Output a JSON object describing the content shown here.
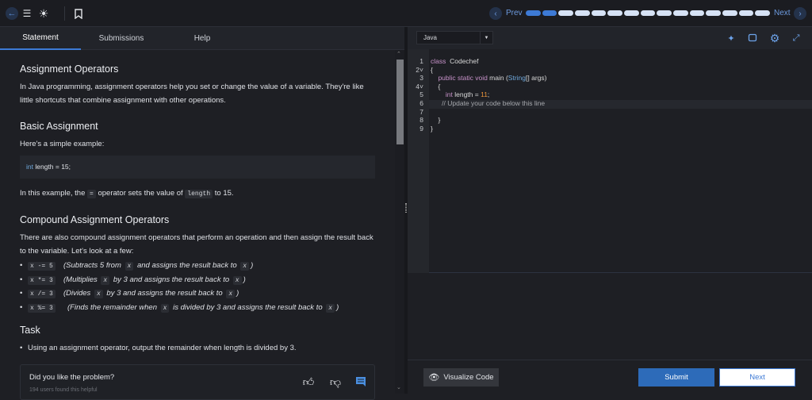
{
  "topbar": {
    "prev_label": "Prev",
    "next_label": "Next",
    "progress": {
      "total": 15,
      "completed": 2
    },
    "colors": {
      "done": "#3d7ad6",
      "todo": "#d6e2f5"
    }
  },
  "tabs": [
    {
      "label": "Statement"
    },
    {
      "label": "Submissions"
    },
    {
      "label": "Help"
    }
  ],
  "statement": {
    "title": "Assignment Operators",
    "intro": "In Java programming, assignment operators help you set or change the value of a variable. They're like little shortcuts that combine assignment with other operations.",
    "basic_heading": "Basic Assignment",
    "basic_text": "Here's a simple example:",
    "example_kw": "int",
    "example_rest": " length = 15;",
    "explain_pre": "In this example, the ",
    "explain_op": "=",
    "explain_mid": " operator sets the value of ",
    "explain_var": "length",
    "explain_post": " to 15.",
    "compound_heading": "Compound Assignment Operators",
    "compound_text": "There are also compound assignment operators that perform an operation and then assign the result back to the variable. Let's look at a few:",
    "ops": [
      {
        "op": "x -= 5",
        "desc": [
          "(Subtracts 5 from ",
          "x",
          " and assigns the result back to ",
          "x",
          ")"
        ]
      },
      {
        "op": "x *= 3",
        "desc": [
          "(Multiplies ",
          "x",
          " by 3 and assigns the result back to ",
          "x",
          ")"
        ]
      },
      {
        "op": "x /= 3",
        "desc": [
          "(Divides ",
          "x",
          " by 3 and assigns the result back to ",
          "x",
          ")"
        ]
      },
      {
        "op": "x %= 3",
        "desc": [
          "(Finds the remainder when ",
          "x",
          " is divided by 3 and assigns the result back to ",
          "x",
          ")"
        ]
      }
    ],
    "task_heading": "Task",
    "task_item": "Using an assignment operator, output the remainder when length is divided by 3."
  },
  "feedback": {
    "question": "Did you like the problem?",
    "helpful": "194 users found this helpful"
  },
  "editor": {
    "language": "Java",
    "lines": [
      [
        [
          "kw",
          "class"
        ],
        [
          "",
          "  Codechef"
        ]
      ],
      [
        [
          "",
          "{"
        ]
      ],
      [
        [
          "kw",
          "    public static void"
        ],
        [
          "",
          " main ("
        ],
        [
          "ty",
          "String"
        ],
        [
          "",
          "[] args)"
        ]
      ],
      [
        [
          "",
          "    {"
        ]
      ],
      [
        [
          "kw",
          "        int"
        ],
        [
          "",
          " length = "
        ],
        [
          "num",
          "11"
        ],
        [
          "",
          ";"
        ]
      ],
      [
        [
          "cm",
          "      // Update your code below this line"
        ]
      ],
      [
        [
          "",
          ""
        ]
      ],
      [
        [
          "",
          "    }"
        ]
      ],
      [
        [
          "",
          "}"
        ]
      ]
    ]
  },
  "actions": {
    "visualize_label": "Visualize Code",
    "submit_label": "Submit",
    "next_label": "Next"
  }
}
